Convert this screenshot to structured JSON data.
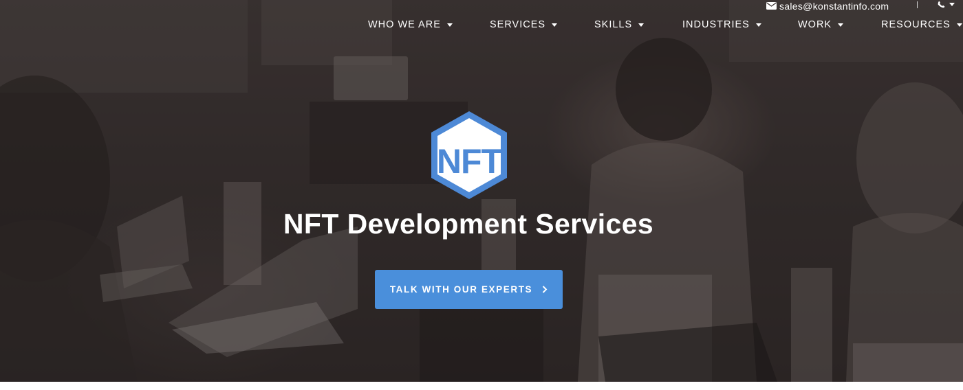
{
  "topbar": {
    "email": "sales@konstantinfo.com",
    "email_icon": "envelope-icon",
    "phone_icon": "phone-icon"
  },
  "nav": {
    "items": [
      {
        "label": "WHO WE ARE"
      },
      {
        "label": "SERVICES"
      },
      {
        "label": "SKILLS"
      },
      {
        "label": "INDUSTRIES"
      },
      {
        "label": "WORK"
      },
      {
        "label": "RESOURCES"
      }
    ]
  },
  "hero": {
    "logo_text": "NFT",
    "title": "NFT Development Services",
    "cta_label": "TALK WITH OUR EXPERTS"
  },
  "colors": {
    "accent": "#4a8fdb",
    "logo_blue": "#4d89d6",
    "overlay": "#332c2b",
    "text": "#ffffff"
  }
}
